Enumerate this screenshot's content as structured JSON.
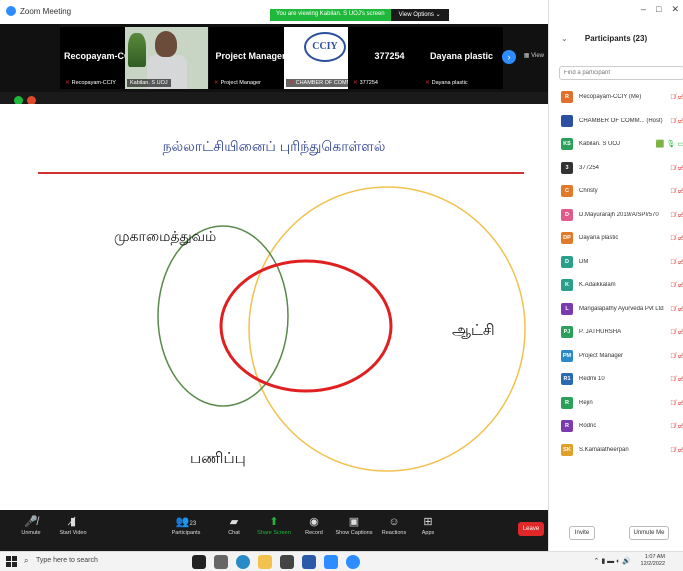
{
  "window": {
    "title": "Zoom Meeting"
  },
  "banner": {
    "viewing": "You are viewing Kabilan. S UOJ's screen",
    "view_options": "View Options ⌄"
  },
  "strip": {
    "tiles": [
      {
        "big": "Recopayam-CCIY",
        "label": "Recopayam-CCIY"
      },
      {
        "big": "",
        "label": "Kabilan. S UOJ"
      },
      {
        "big": "Project Manager",
        "label": "Project Manager"
      },
      {
        "big": "",
        "label": "CHAMBER OF COMME..."
      },
      {
        "big": "377254",
        "label": "377254"
      },
      {
        "big": "Dayana plastic",
        "label": "Dayana plastic"
      }
    ],
    "logo_text": "CCIY",
    "view_label": "▦ View",
    "next_glyph": "›"
  },
  "slide": {
    "heading": "நல்லாட்சியினைப் புரிந்துகொள்ளல்",
    "label_left": "முகாமைத்துவம்",
    "label_right": "ஆட்சி",
    "label_bottom": "பணிப்பு"
  },
  "toolbar": {
    "unmute": "Unmute",
    "start_video": "Start Video",
    "participants": "Participants",
    "participants_count": "23",
    "chat": "Chat",
    "share_screen": "Share Screen",
    "record": "Record",
    "show_captions": "Show Captions",
    "reactions": "Reactions",
    "apps": "Apps",
    "leave": "Leave"
  },
  "panel": {
    "title": "Participants (23)",
    "search_placeholder": "Find a participant",
    "participants": [
      {
        "initials": "R",
        "name": "Recopayam-CCIY (Me)",
        "color": "#e0702a"
      },
      {
        "initials": "",
        "name": "CHAMBER OF COMM... (Host)",
        "color": "#2d4fa0"
      },
      {
        "initials": "KS",
        "name": "Kabilan. S UOJ",
        "color": "#2aa05a"
      },
      {
        "initials": "3",
        "name": "377254",
        "color": "#333333"
      },
      {
        "initials": "C",
        "name": "Christy",
        "color": "#e07a2a"
      },
      {
        "initials": "D",
        "name": "D.Mayurarajh 2019/A/SPI/570",
        "color": "#e05a8a"
      },
      {
        "initials": "DP",
        "name": "Dayana plastic",
        "color": "#e07a2a"
      },
      {
        "initials": "D",
        "name": "DM",
        "color": "#2aa08a"
      },
      {
        "initials": "K",
        "name": "K.Adaikkalam",
        "color": "#2aa08a"
      },
      {
        "initials": "L",
        "name": "Mangalapathy Ayurveda Pvt Ltd",
        "color": "#7a3ab0"
      },
      {
        "initials": "PJ",
        "name": "P. JATHURSHA",
        "color": "#2aa05a"
      },
      {
        "initials": "PM",
        "name": "Project Manager",
        "color": "#2a8ac8"
      },
      {
        "initials": "R1",
        "name": "Redmi 10",
        "color": "#2a6ab0"
      },
      {
        "initials": "R",
        "name": "Rejin",
        "color": "#2aa05a"
      },
      {
        "initials": "R",
        "name": "Rodric",
        "color": "#7a3ab0"
      },
      {
        "initials": "SK",
        "name": "S.Kamalatheerpan",
        "color": "#e0a02a"
      }
    ],
    "invite": "Invite",
    "unmute_me": "Unmute Me"
  },
  "taskbar": {
    "search_placeholder": "Type here to search",
    "time": "1:07 AM",
    "date": "12/2/2022"
  },
  "colors": {
    "accent": "#2d8cff",
    "leave": "#e02828",
    "share": "#1fb83a",
    "venn_green": "#5a8a4a",
    "venn_yellow": "#f2c14e",
    "venn_red": "#e02020"
  }
}
